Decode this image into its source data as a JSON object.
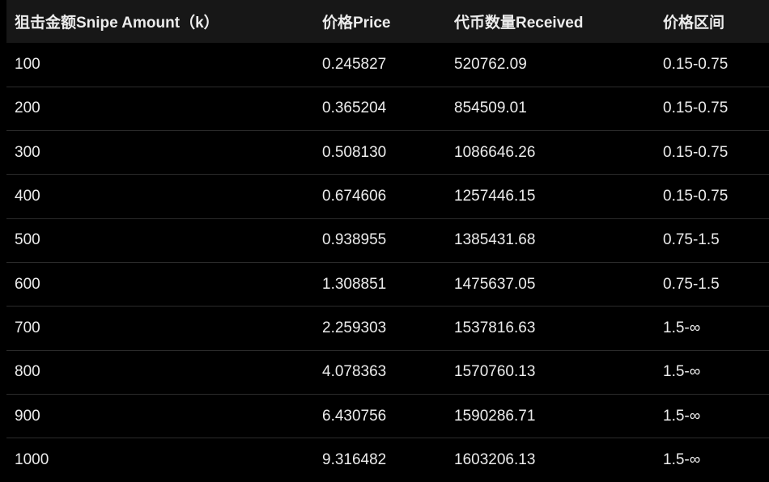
{
  "table": {
    "headers": [
      "狙击金额Snipe Amount（k）",
      "价格Price",
      "代币数量Received",
      "价格区间"
    ],
    "rows": [
      [
        "100",
        "0.245827",
        "520762.09",
        "0.15-0.75"
      ],
      [
        "200",
        "0.365204",
        "854509.01",
        "0.15-0.75"
      ],
      [
        "300",
        "0.508130",
        "1086646.26",
        "0.15-0.75"
      ],
      [
        "400",
        "0.674606",
        "1257446.15",
        "0.15-0.75"
      ],
      [
        "500",
        "0.938955",
        "1385431.68",
        "0.75-1.5"
      ],
      [
        "600",
        "1.308851",
        "1475637.05",
        "0.75-1.5"
      ],
      [
        "700",
        "2.259303",
        "1537816.63",
        "1.5-∞"
      ],
      [
        "800",
        "4.078363",
        "1570760.13",
        "1.5-∞"
      ],
      [
        "900",
        "6.430756",
        "1590286.71",
        "1.5-∞"
      ],
      [
        "1000",
        "9.316482",
        "1603206.13",
        "1.5-∞"
      ]
    ]
  }
}
